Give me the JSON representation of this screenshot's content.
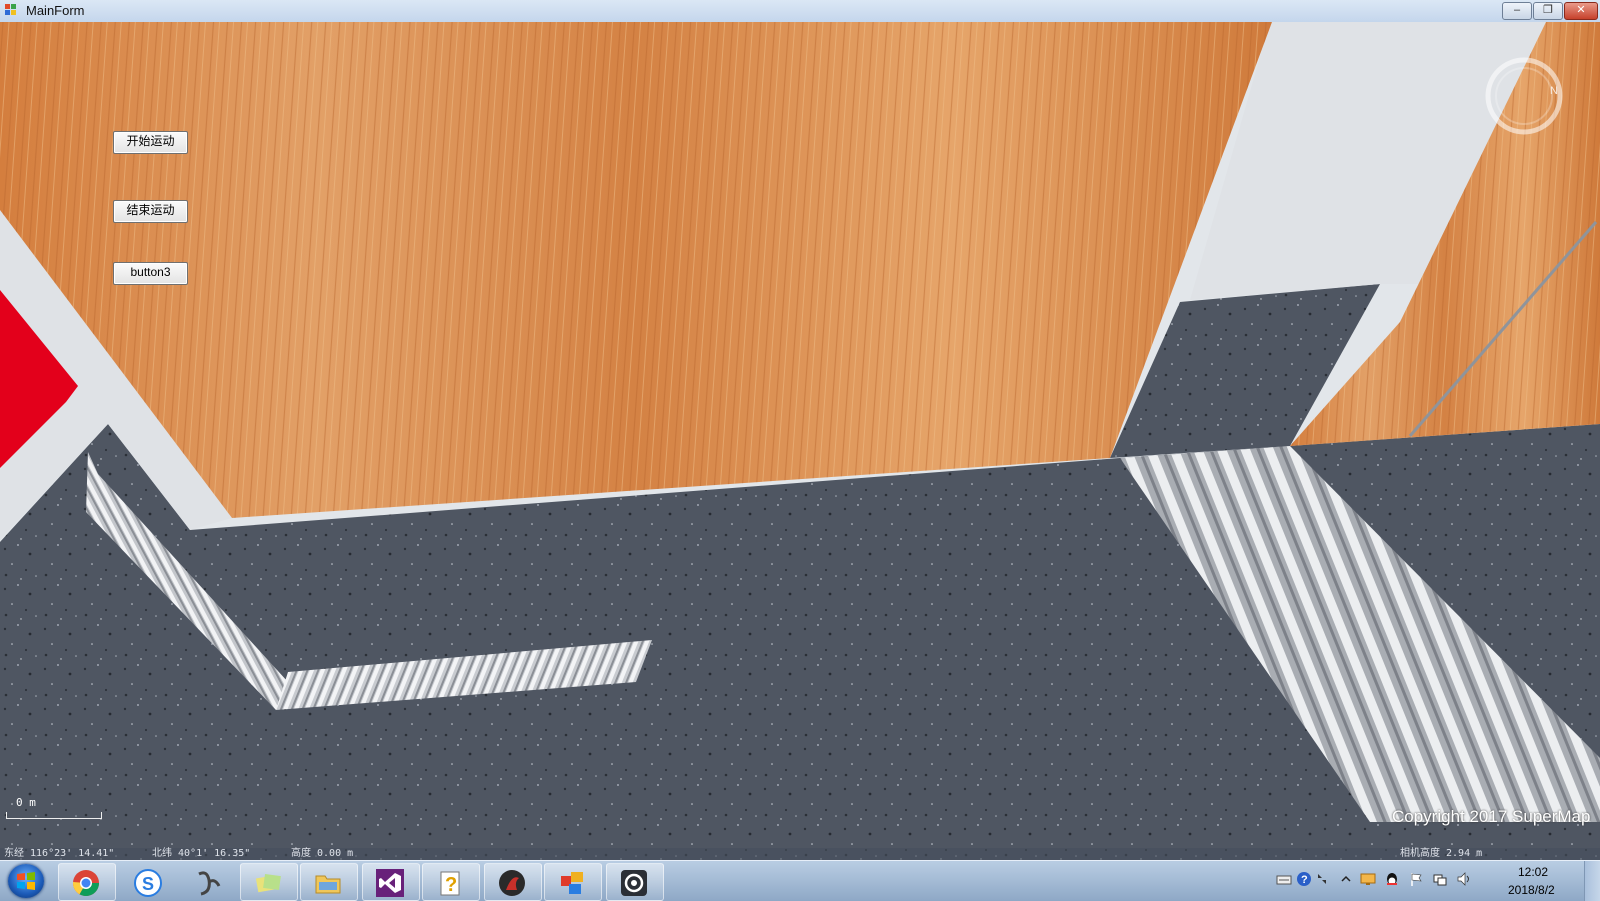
{
  "window": {
    "title": "MainForm",
    "controls": {
      "minimize": "–",
      "restore": "❐",
      "close": "✕"
    }
  },
  "form_buttons": [
    {
      "label": "开始运动"
    },
    {
      "label": "结束运动"
    },
    {
      "label": "button3"
    }
  ],
  "viewer": {
    "compass_letter": "N",
    "scale_label": "0 m",
    "copyright": "Copyright 2017 SuperMap",
    "status": {
      "longitude": "东经 116°23' 14.41\"",
      "latitude": "北纬 40°1' 16.35\"",
      "height": "高度 0.00 m",
      "camera_height": "相机高度 2.94 m"
    }
  },
  "taskbar": {
    "start_icon": "windows-orb-icon",
    "apps": [
      {
        "icon": "chrome-icon"
      },
      {
        "icon": "sogou-icon"
      },
      {
        "icon": "ink-app-icon"
      },
      {
        "icon": "sticky-notes-icon"
      },
      {
        "icon": "file-explorer-icon"
      },
      {
        "icon": "visual-studio-icon"
      },
      {
        "icon": "help-viewer-icon"
      },
      {
        "icon": "media-app-icon"
      },
      {
        "icon": "supermap-app-icon"
      },
      {
        "icon": "mainform-app-icon"
      }
    ],
    "tray_icons": [
      "keyboard-icon",
      "help-icon",
      "network-arrows-icon",
      "show-hidden-icon",
      "monitor-icon",
      "qq-icon",
      "action-center-flag-icon",
      "network-icon",
      "volume-icon"
    ],
    "clock": {
      "time": "12:02",
      "date": "2018/8/2"
    }
  },
  "colors": {
    "wood": "#d98c4c",
    "floor": "#4f5662",
    "wall": "#dfe3e7",
    "red_object": "#e3001b",
    "metal": "#c9ccd1"
  }
}
